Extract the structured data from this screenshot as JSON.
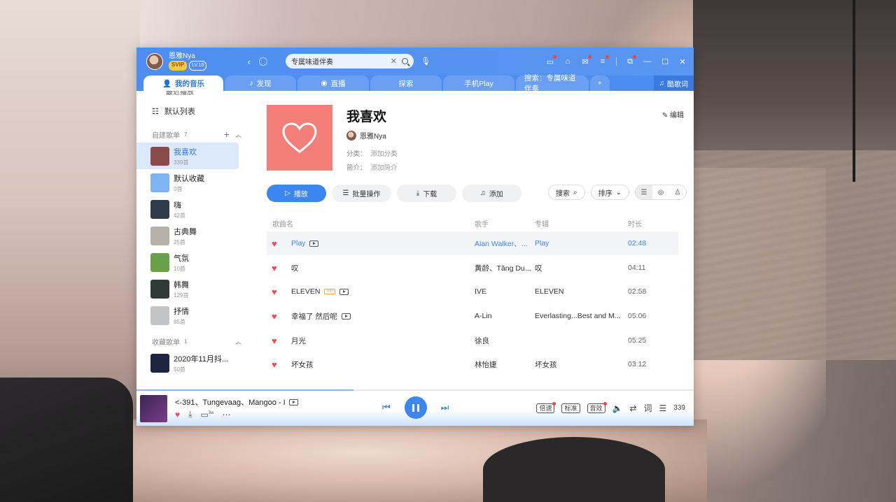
{
  "user": {
    "name": "恩雅Nya",
    "badge_svip": "SVIP",
    "level": "LV.10"
  },
  "search": {
    "value": "专属味道伴奏"
  },
  "tabs": [
    {
      "label": "我的音乐",
      "icon": "person-icon",
      "active": true
    },
    {
      "label": "发现",
      "icon": "music-note-icon"
    },
    {
      "label": "直播",
      "icon": "live-icon"
    },
    {
      "label": "探索"
    },
    {
      "label": "手机Play"
    },
    {
      "label": "搜索：专属味道伴奏"
    },
    {
      "label": "+"
    }
  ],
  "lyric_button": "酷歌词",
  "sidebar": {
    "cut_item": "最近播放",
    "default_list": "默认列表",
    "created_header": "自建歌单",
    "created_count": "7",
    "created": [
      {
        "name": "我喜欢",
        "count": "339首",
        "color": "#8a4a4a"
      },
      {
        "name": "默认收藏",
        "count": "0首",
        "color": "#7eb3f1"
      },
      {
        "name": "嗨",
        "count": "42首",
        "color": "#2e3b4a"
      },
      {
        "name": "古典舞",
        "count": "25首",
        "color": "#b7b2a8"
      },
      {
        "name": "气氛",
        "count": "10首",
        "color": "#6aa04a"
      },
      {
        "name": "韩舞",
        "count": "129首",
        "color": "#2f3a36"
      },
      {
        "name": "抒情",
        "count": "85首",
        "color": "#c2c4c6"
      }
    ],
    "collected_header": "收藏歌单",
    "collected_count": "1",
    "collected": [
      {
        "name": "2020年11月抖...",
        "count": "50首",
        "color": "#1e2540"
      }
    ]
  },
  "playlist": {
    "title": "我喜欢",
    "owner": "恩雅Nya",
    "category_label": "分类：",
    "category_value": "添加分类",
    "intro_label": "简介：",
    "intro_value": "添加简介",
    "edit": "编辑"
  },
  "actions": {
    "play": "播放",
    "batch": "批量操作",
    "download": "下载",
    "add": "添加",
    "search": "搜索",
    "sort": "排序"
  },
  "table": {
    "headers": {
      "name": "歌曲名",
      "artist": "歌手",
      "album": "专辑",
      "time": "时长"
    },
    "rows": [
      {
        "name": "Play",
        "artist": "Alan Walker、...",
        "album": "Play",
        "time": "02:48",
        "mv": true,
        "vip": false,
        "active": true
      },
      {
        "name": "叹",
        "artist": "黄龄、Tăng Du...",
        "album": "叹",
        "time": "04:11",
        "mv": false,
        "vip": false
      },
      {
        "name": "ELEVEN",
        "artist": "IVE",
        "album": "ELEVEN",
        "time": "02:58",
        "mv": true,
        "vip": true
      },
      {
        "name": "幸福了 然后呢",
        "artist": "A-Lin",
        "album": "Everlasting...Best and M...",
        "time": "05:06",
        "mv": true,
        "vip": false
      },
      {
        "name": "月光",
        "artist": "徐良",
        "album": "",
        "time": "05:25",
        "mv": false,
        "vip": false
      },
      {
        "name": "坏女孩",
        "artist": "林怡婕",
        "album": "坏女孩",
        "time": "03:12",
        "mv": false,
        "vip": false
      }
    ]
  },
  "player": {
    "now_playing": "<-391、Tungevaag、Mangoo - I",
    "download_badge": "3w",
    "speed": "倍速",
    "quality": "标准",
    "effect": "音效",
    "lyrics": "词",
    "count": "339",
    "progress": 0.39
  },
  "vip_tag": "VIP"
}
